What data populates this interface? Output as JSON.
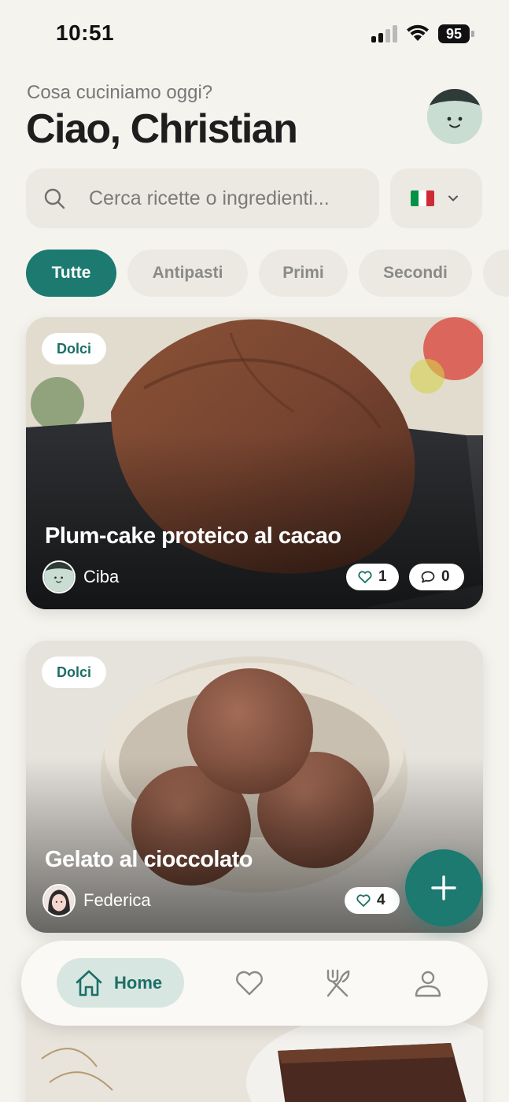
{
  "status_bar": {
    "time": "10:51",
    "battery": "95"
  },
  "header": {
    "subtitle": "Cosa cuciniamo oggi?",
    "greeting": "Ciao, Christian",
    "avatar_icon": "smiley-avatar"
  },
  "search": {
    "placeholder": "Cerca ricette o ingredienti...",
    "icon": "search-icon"
  },
  "language": {
    "selected": "it",
    "flag_colors": [
      "#009246",
      "#ffffff",
      "#ce2b37"
    ]
  },
  "categories": {
    "items": [
      {
        "label": "Tutte",
        "active": true
      },
      {
        "label": "Antipasti",
        "active": false
      },
      {
        "label": "Primi",
        "active": false
      },
      {
        "label": "Secondi",
        "active": false
      },
      {
        "label": "",
        "active": false
      }
    ]
  },
  "recipes": [
    {
      "category": "Dolci",
      "title": "Plum-cake proteico al cacao",
      "author": "Ciba",
      "likes": "1",
      "comments": "0"
    },
    {
      "category": "Dolci",
      "title": "Gelato al cioccolato",
      "author": "Federica",
      "likes": "4"
    }
  ],
  "nav": {
    "home_label": "Home",
    "items": [
      "home-icon",
      "heart-icon",
      "utensils-icon",
      "profile-icon"
    ]
  },
  "colors": {
    "accent": "#1c7a70",
    "background": "#f5f3ee",
    "chip_inactive": "#ebe9e2",
    "badge_text": "#1c6f66"
  }
}
